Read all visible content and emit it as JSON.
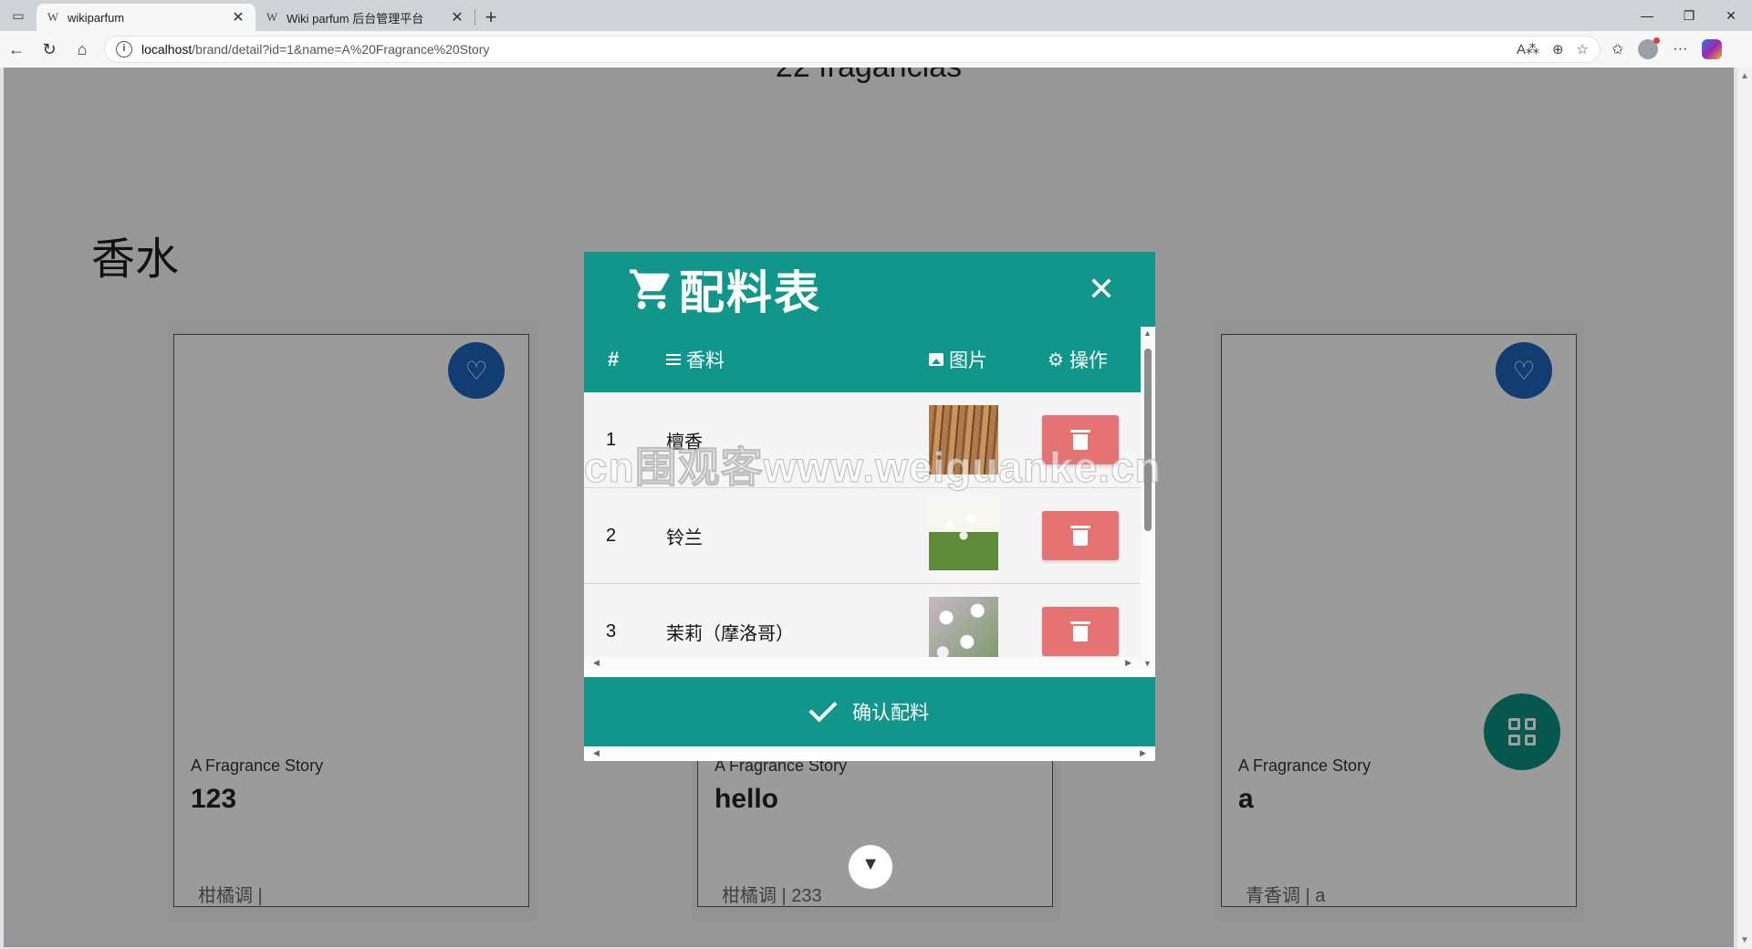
{
  "browser": {
    "tabs": [
      {
        "favicon": "W",
        "title": "wikiparfum",
        "active": true
      },
      {
        "favicon": "W",
        "title": "Wiki parfum 后台管理平台",
        "active": false
      }
    ],
    "url_host": "localhost",
    "url_path": "/brand/detail?id=1&name=A%20Fragrance%20Story"
  },
  "page": {
    "count_title": "22 fragancias",
    "section_title": "香水",
    "cards": [
      {
        "brand": "A Fragrance Story",
        "name": "123",
        "tags": "柑橘调 |"
      },
      {
        "brand": "A Fragrance Story",
        "name": "hello",
        "tags": "柑橘调 | 233"
      },
      {
        "brand": "A Fragrance Story",
        "name": "a",
        "tags": "青香调 | a"
      }
    ]
  },
  "modal": {
    "title": "配料表",
    "columns": {
      "num": "#",
      "name": "香料",
      "image": "图片",
      "action": "操作"
    },
    "rows": [
      {
        "num": "1",
        "name": "檀香",
        "image": "sandalwood-thumbnail"
      },
      {
        "num": "2",
        "name": "铃兰",
        "image": "lily-of-the-valley-thumbnail"
      },
      {
        "num": "3",
        "name": "茉莉（摩洛哥）",
        "image": "moroccan-jasmine-thumbnail"
      }
    ],
    "confirm_label": "确认配料"
  },
  "watermark": "cn围观客www.weiguanke.cn",
  "colors": {
    "modal_teal": "#12958a",
    "delete_red": "#e57373",
    "favorite_blue": "#1e63b8",
    "fab_teal": "#0a8f7f"
  },
  "icons": {
    "cart": "shopping-cart-icon",
    "close": "close-icon",
    "list": "list-icon",
    "image": "image-icon",
    "gear": "gear-icon",
    "trash": "trash-icon",
    "check": "check-icon",
    "heart": "heart-icon",
    "grid": "grid-icon"
  }
}
